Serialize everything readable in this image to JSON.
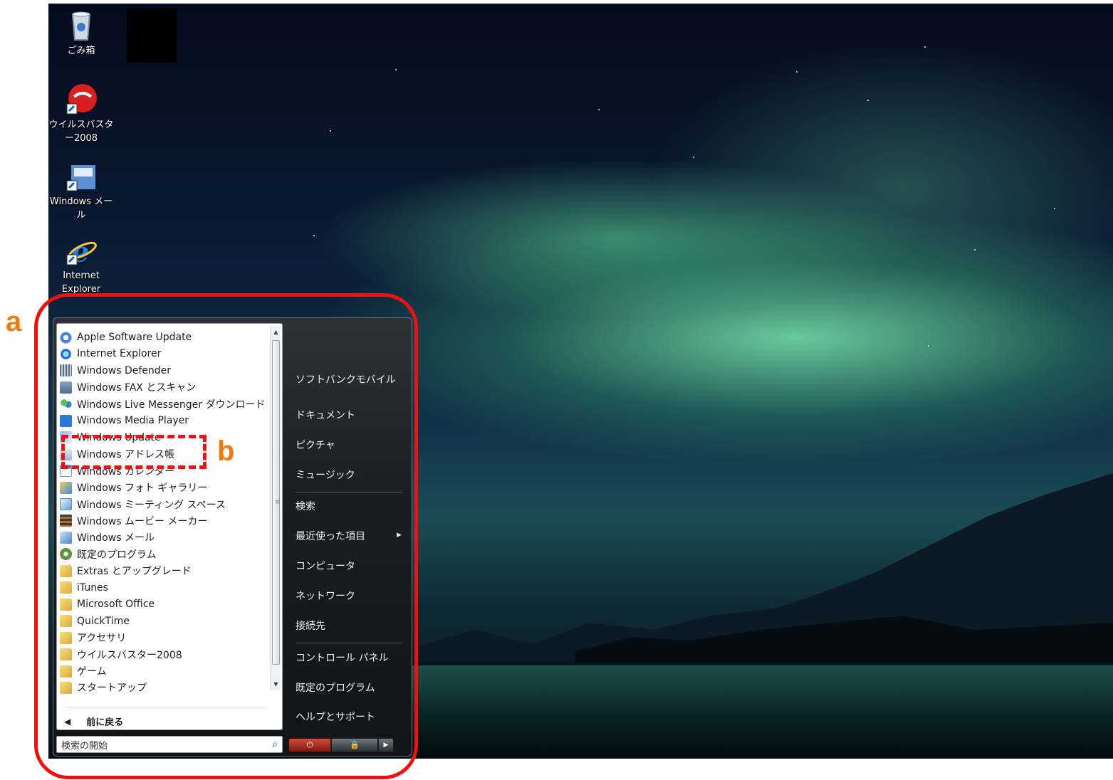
{
  "desktop": {
    "icons": [
      {
        "label": "ごみ箱",
        "icon": "recycle-bin-icon"
      },
      {
        "label": "ウイルスバスター2008",
        "icon": "virusbuster-icon"
      },
      {
        "label": "Windows メール",
        "icon": "windows-mail-icon"
      },
      {
        "label": "Internet Explorer",
        "icon": "internet-explorer-icon"
      }
    ]
  },
  "start_menu": {
    "programs": [
      {
        "label": "Apple Software Update",
        "icon": "apple"
      },
      {
        "label": "Internet Explorer",
        "icon": "ie"
      },
      {
        "label": "Windows Defender",
        "icon": "defender"
      },
      {
        "label": "Windows FAX とスキャン",
        "icon": "fax"
      },
      {
        "label": "Windows Live Messenger ダウンロード",
        "icon": "messenger"
      },
      {
        "label": "Windows Media Player",
        "icon": "wmp"
      },
      {
        "label": "Windows Update",
        "icon": "update"
      },
      {
        "label": "Windows アドレス帳",
        "icon": "addr"
      },
      {
        "label": "Windows カレンダー",
        "icon": "cal"
      },
      {
        "label": "Windows フォト ギャラリー",
        "icon": "photo"
      },
      {
        "label": "Windows ミーティング スペース",
        "icon": "meeting"
      },
      {
        "label": "Windows ムービー メーカー",
        "icon": "movie"
      },
      {
        "label": "Windows メール",
        "icon": "mail"
      },
      {
        "label": "既定のプログラム",
        "icon": "defprog"
      },
      {
        "label": "Extras とアップグレード",
        "icon": "folder"
      },
      {
        "label": "iTunes",
        "icon": "folder"
      },
      {
        "label": "Microsoft Office",
        "icon": "folder"
      },
      {
        "label": "QuickTime",
        "icon": "folder"
      },
      {
        "label": "アクセサリ",
        "icon": "folder"
      },
      {
        "label": "ウイルスバスター2008",
        "icon": "folder"
      },
      {
        "label": "ゲーム",
        "icon": "folder"
      },
      {
        "label": "スタートアップ",
        "icon": "folder"
      }
    ],
    "back_label": "前に戻る",
    "search_placeholder": "検索の開始",
    "right_links": {
      "user": "ソフトバンクモバイル",
      "documents": "ドキュメント",
      "pictures": "ピクチャ",
      "music": "ミュージック",
      "search": "検索",
      "recent": "最近使った項目",
      "computer": "コンピュータ",
      "network": "ネットワーク",
      "connect": "接続先",
      "control_panel": "コントロール パネル",
      "default_programs": "既定のプログラム",
      "help": "ヘルプとサポート"
    }
  },
  "annotations": {
    "a": "a",
    "b": "b"
  },
  "colors": {
    "annotation_border": "#ee1111",
    "annotation_label": "#f07a10"
  }
}
